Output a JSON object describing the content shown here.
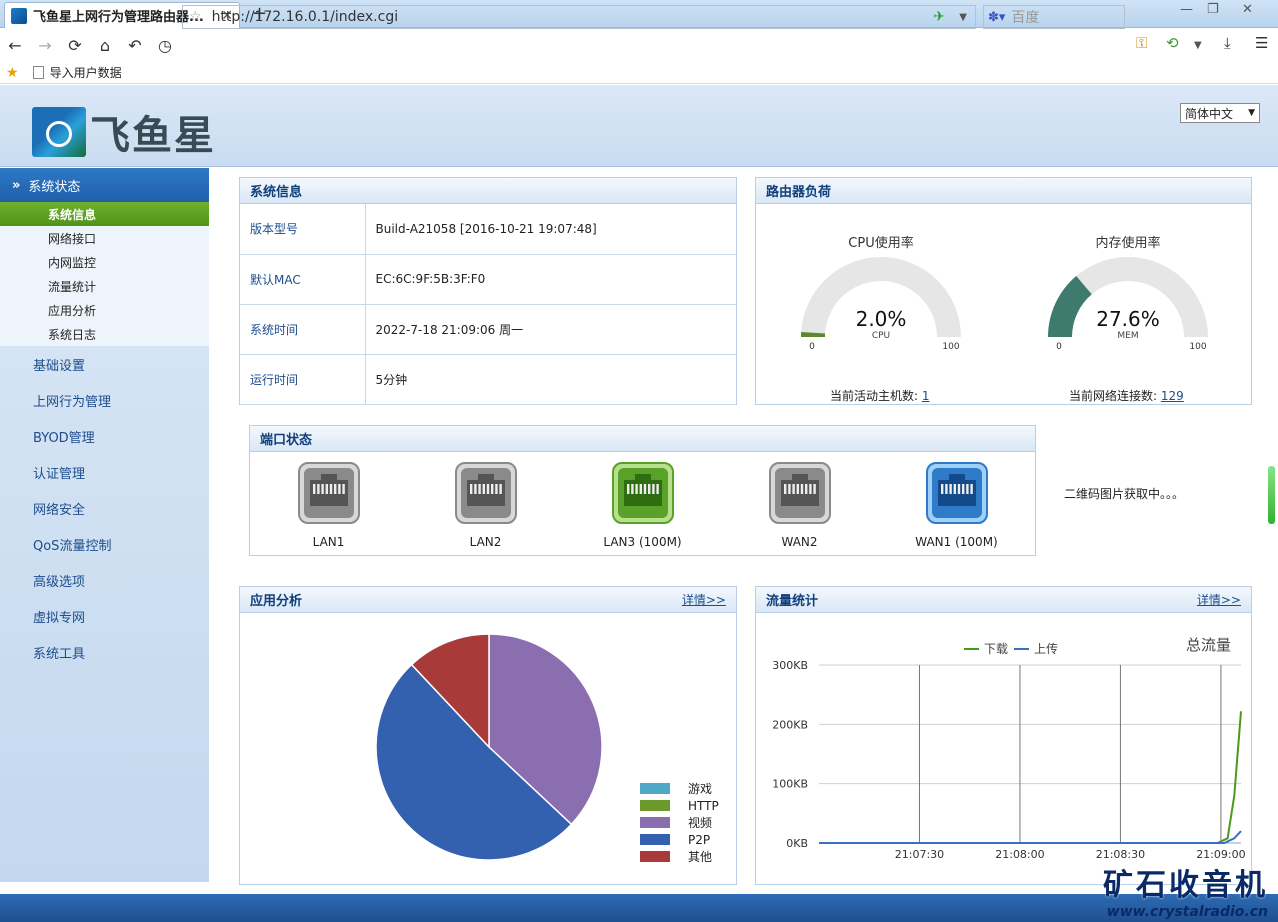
{
  "browser": {
    "tab_title": "飞鱼星上网行为管理路由器...",
    "url": "http://172.16.0.1/index.cgi",
    "search_placeholder": "百度",
    "bookmark": "导入用户数据"
  },
  "header": {
    "brand": "飞鱼星",
    "language": "简体中文"
  },
  "sidebar": {
    "section": "系统状态",
    "sub_items": [
      "系统信息",
      "网络接口",
      "内网监控",
      "流量统计",
      "应用分析",
      "系统日志"
    ],
    "items": [
      "基础设置",
      "上网行为管理",
      "BYOD管理",
      "认证管理",
      "网络安全",
      "QoS流量控制",
      "高级选项",
      "虚拟专网",
      "系统工具"
    ]
  },
  "sysinfo": {
    "title": "系统信息",
    "rows": [
      {
        "key": "版本型号",
        "value": "Build-A21058 [2016-10-21 19:07:48]"
      },
      {
        "key": "默认MAC",
        "value": "EC:6C:9F:5B:3F:F0"
      },
      {
        "key": "系统时间",
        "value": "2022-7-18 21:09:06 周一"
      },
      {
        "key": "运行时间",
        "value": "5分钟"
      }
    ]
  },
  "load": {
    "title": "路由器负荷",
    "cpu": {
      "title": "CPU使用率",
      "value_text": "2.0%",
      "value": 2.0,
      "unit": "CPU",
      "min": "0",
      "max": "100",
      "color": "#5a8a2c"
    },
    "mem": {
      "title": "内存使用率",
      "value_text": "27.6%",
      "value": 27.6,
      "unit": "MEM",
      "min": "0",
      "max": "100",
      "color": "#3f7a6e"
    },
    "hosts_label": "当前活动主机数:",
    "hosts": "1",
    "conns_label": "当前网络连接数:",
    "conns": "129"
  },
  "ports": {
    "title": "端口状态",
    "list": [
      {
        "label": "LAN1",
        "state": "down"
      },
      {
        "label": "LAN2",
        "state": "down"
      },
      {
        "label": "LAN3 (100M)",
        "state": "lan-up"
      },
      {
        "label": "WAN2",
        "state": "down"
      },
      {
        "label": "WAN1 (100M)",
        "state": "wan-up"
      }
    ],
    "qr_text": "二维码图片获取中。。。"
  },
  "app": {
    "title": "应用分析",
    "more": "详情>>",
    "legend": [
      {
        "name": "游戏",
        "color": "#4fa8c8"
      },
      {
        "name": "HTTP",
        "color": "#6b9a2a"
      },
      {
        "name": "视频",
        "color": "#8a6eb0"
      },
      {
        "name": "P2P",
        "color": "#3460b0"
      },
      {
        "name": "其他",
        "color": "#a83a3a"
      }
    ]
  },
  "traffic": {
    "title": "流量统计",
    "more": "详情>>",
    "chart_title": "总流量",
    "legend_down": "下载",
    "legend_up": "上传"
  },
  "chart_data": [
    {
      "type": "pie",
      "title": "",
      "slices": [
        {
          "name": "游戏",
          "value": 0,
          "color": "#4fa8c8"
        },
        {
          "name": "HTTP",
          "value": 0,
          "color": "#6b9a2a"
        },
        {
          "name": "视频",
          "value": 37,
          "color": "#8a6eb0"
        },
        {
          "name": "P2P",
          "value": 51,
          "color": "#3460b0"
        },
        {
          "name": "其他",
          "value": 12,
          "color": "#a83a3a"
        }
      ]
    },
    {
      "type": "line",
      "title": "总流量",
      "x_ticks": [
        "21:07:30",
        "21:08:00",
        "21:08:30",
        "21:09:00"
      ],
      "y_ticks": [
        "300KB",
        "200KB",
        "100KB",
        "0KB"
      ],
      "ylim": [
        0,
        300
      ],
      "xlim_seconds": [
        "21:07:00",
        "21:09:06"
      ],
      "series": [
        {
          "name": "下载",
          "color": "#4a9a1e",
          "points": [
            [
              "21:07:00",
              0
            ],
            [
              "21:08:59",
              0
            ],
            [
              "21:09:02",
              8
            ],
            [
              "21:09:04",
              80
            ],
            [
              "21:09:06",
              222
            ]
          ]
        },
        {
          "name": "上传",
          "color": "#3b6fc2",
          "points": [
            [
              "21:07:00",
              0
            ],
            [
              "21:09:01",
              0
            ],
            [
              "21:09:04",
              8
            ],
            [
              "21:09:06",
              20
            ]
          ]
        }
      ],
      "grid": true,
      "legend": "top"
    }
  ]
}
